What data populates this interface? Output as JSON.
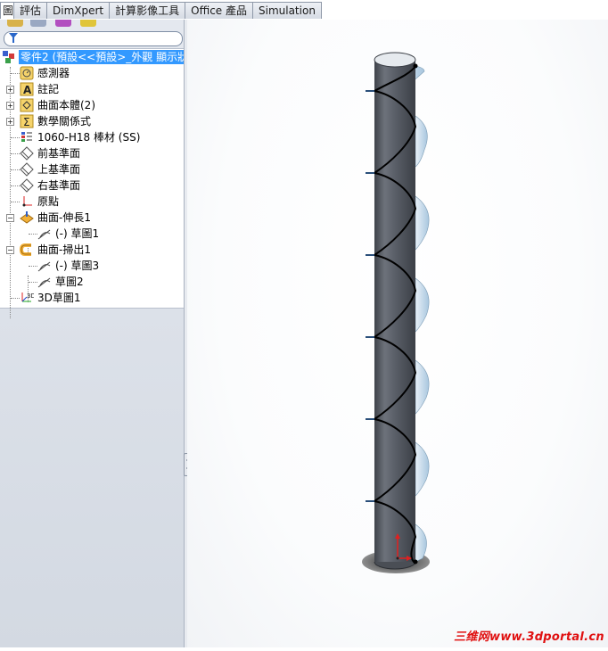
{
  "tabs": [
    {
      "label": "圖"
    },
    {
      "label": "評估"
    },
    {
      "label": "DimXpert"
    },
    {
      "label": "計算影像工具"
    },
    {
      "label": "Office 產品"
    },
    {
      "label": "Simulation"
    }
  ],
  "tree": {
    "root": "零件2  (預設<<預設>_外觀 顯示狀",
    "items": [
      {
        "label": "感測器",
        "icon": "sensor-icon"
      },
      {
        "label": "註記",
        "icon": "annotation-icon"
      },
      {
        "label": "曲面本體(2)",
        "icon": "surface-bodies-icon"
      },
      {
        "label": "數學關係式",
        "icon": "equations-icon"
      },
      {
        "label": "1060-H18 棒材 (SS)",
        "icon": "material-icon"
      },
      {
        "label": "前基準面",
        "icon": "plane-icon"
      },
      {
        "label": "上基準面",
        "icon": "plane-icon"
      },
      {
        "label": "右基準面",
        "icon": "plane-icon"
      },
      {
        "label": "原點",
        "icon": "origin-icon"
      },
      {
        "label": "曲面-伸長1",
        "icon": "surface-extrude-icon"
      },
      {
        "label": "(-) 草圖1",
        "icon": "sketch-icon"
      },
      {
        "label": "曲面-掃出1",
        "icon": "surface-sweep-icon"
      },
      {
        "label": "(-) 草圖3",
        "icon": "sketch-icon"
      },
      {
        "label": "草圖2",
        "icon": "sketch-icon"
      },
      {
        "label": "3D草圖1",
        "icon": "sketch3d-icon"
      }
    ]
  },
  "watermark": "三维网www.3dportal.cn",
  "colors": {
    "selection": "#3399ff",
    "cylinder": "#555a63",
    "helix": "#000000",
    "flange": "#bcd3e6",
    "axis_red": "#e02020"
  }
}
